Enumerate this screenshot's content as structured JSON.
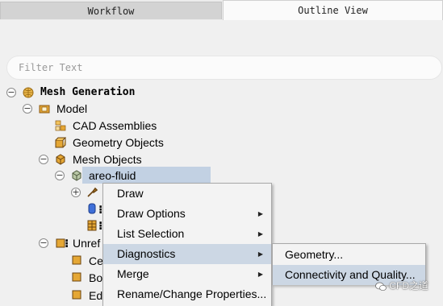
{
  "tabs": {
    "workflow": "Workflow",
    "outline": "Outline View"
  },
  "filter": {
    "placeholder": "Filter Text"
  },
  "tree": {
    "root": "Mesh Generation",
    "model": "Model",
    "cad_assemblies": "CAD Assemblies",
    "geometry_objects": "Geometry Objects",
    "mesh_objects": "Mesh Objects",
    "areo_fluid": "areo-fluid",
    "unref": "Unref",
    "ce": "Ce",
    "bo": "Bo",
    "ed": "Ed"
  },
  "context_menu": {
    "items": [
      "Draw",
      "Draw Options",
      "List Selection",
      "Diagnostics",
      "Merge",
      "Rename/Change Properties..."
    ],
    "highlighted": "Diagnostics"
  },
  "submenu": {
    "items": [
      "Geometry...",
      "Connectivity and Quality..."
    ],
    "highlighted": "Connectivity and Quality..."
  },
  "watermark": "CFD之道",
  "icons": [
    "collapse-toggle-icon",
    "expand-toggle-icon",
    "mesh-generation-globe-icon",
    "model-box-icon",
    "cad-assemblies-icon",
    "geometry-objects-icon",
    "mesh-objects-icon",
    "mesh-object-cube-icon",
    "submenu-arrow-icon",
    "wechat-icon"
  ],
  "colors": {
    "selection": "#c2d1e3",
    "menu_highlight": "#ccd7e4",
    "menu_bg": "#f3f3f3",
    "panel_bg": "#f0f0f0"
  }
}
